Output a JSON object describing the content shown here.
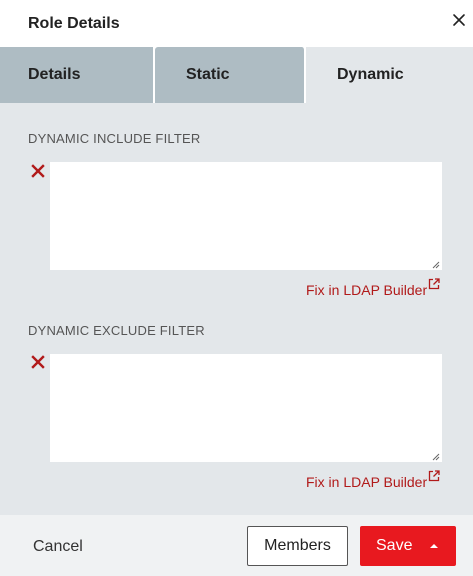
{
  "dialog": {
    "title": "Role Details",
    "close_icon": "close-icon"
  },
  "tabs": [
    {
      "label": "Details",
      "active": false
    },
    {
      "label": "Static",
      "active": false
    },
    {
      "label": "Dynamic",
      "active": true
    }
  ],
  "include_filter": {
    "label": "DYNAMIC INCLUDE FILTER",
    "value": "",
    "link_label": "Fix in LDAP Builder",
    "remove_icon": "remove-x-icon",
    "link_icon": "external-link-icon"
  },
  "exclude_filter": {
    "label": "DYNAMIC EXCLUDE FILTER",
    "value": "",
    "link_label": "Fix in LDAP Builder",
    "remove_icon": "remove-x-icon",
    "link_icon": "external-link-icon"
  },
  "footer": {
    "cancel_label": "Cancel",
    "members_label": "Members",
    "save_label": "Save",
    "save_icon": "caret-up-icon"
  },
  "colors": {
    "accent_red": "#e8191f",
    "link_red": "#b11a1a",
    "panel_bg": "#e3e7ea",
    "inactive_tab": "#aebcc3"
  }
}
